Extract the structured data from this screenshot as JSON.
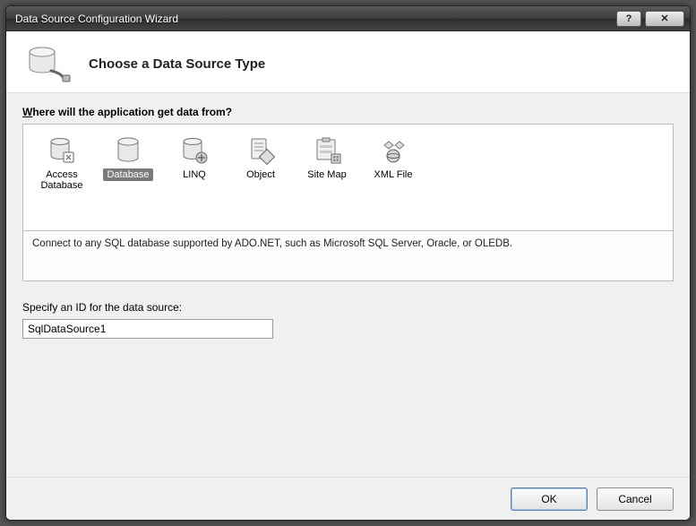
{
  "window": {
    "title": "Data Source Configuration Wizard"
  },
  "header": {
    "title": "Choose a Data Source Type"
  },
  "prompt_prefix": "W",
  "prompt_rest": "here will the application get data from?",
  "options": [
    {
      "label": "Access Database"
    },
    {
      "label": "Database"
    },
    {
      "label": "LINQ"
    },
    {
      "label": "Object"
    },
    {
      "label": "Site Map"
    },
    {
      "label": "XML File"
    }
  ],
  "selected_index": 1,
  "description": "Connect to any SQL database supported by ADO.NET, such as Microsoft SQL Server, Oracle, or OLEDB.",
  "id_label": "Specify an ID for the data source:",
  "id_value": "SqlDataSource1",
  "buttons": {
    "ok": "OK",
    "cancel": "Cancel"
  }
}
